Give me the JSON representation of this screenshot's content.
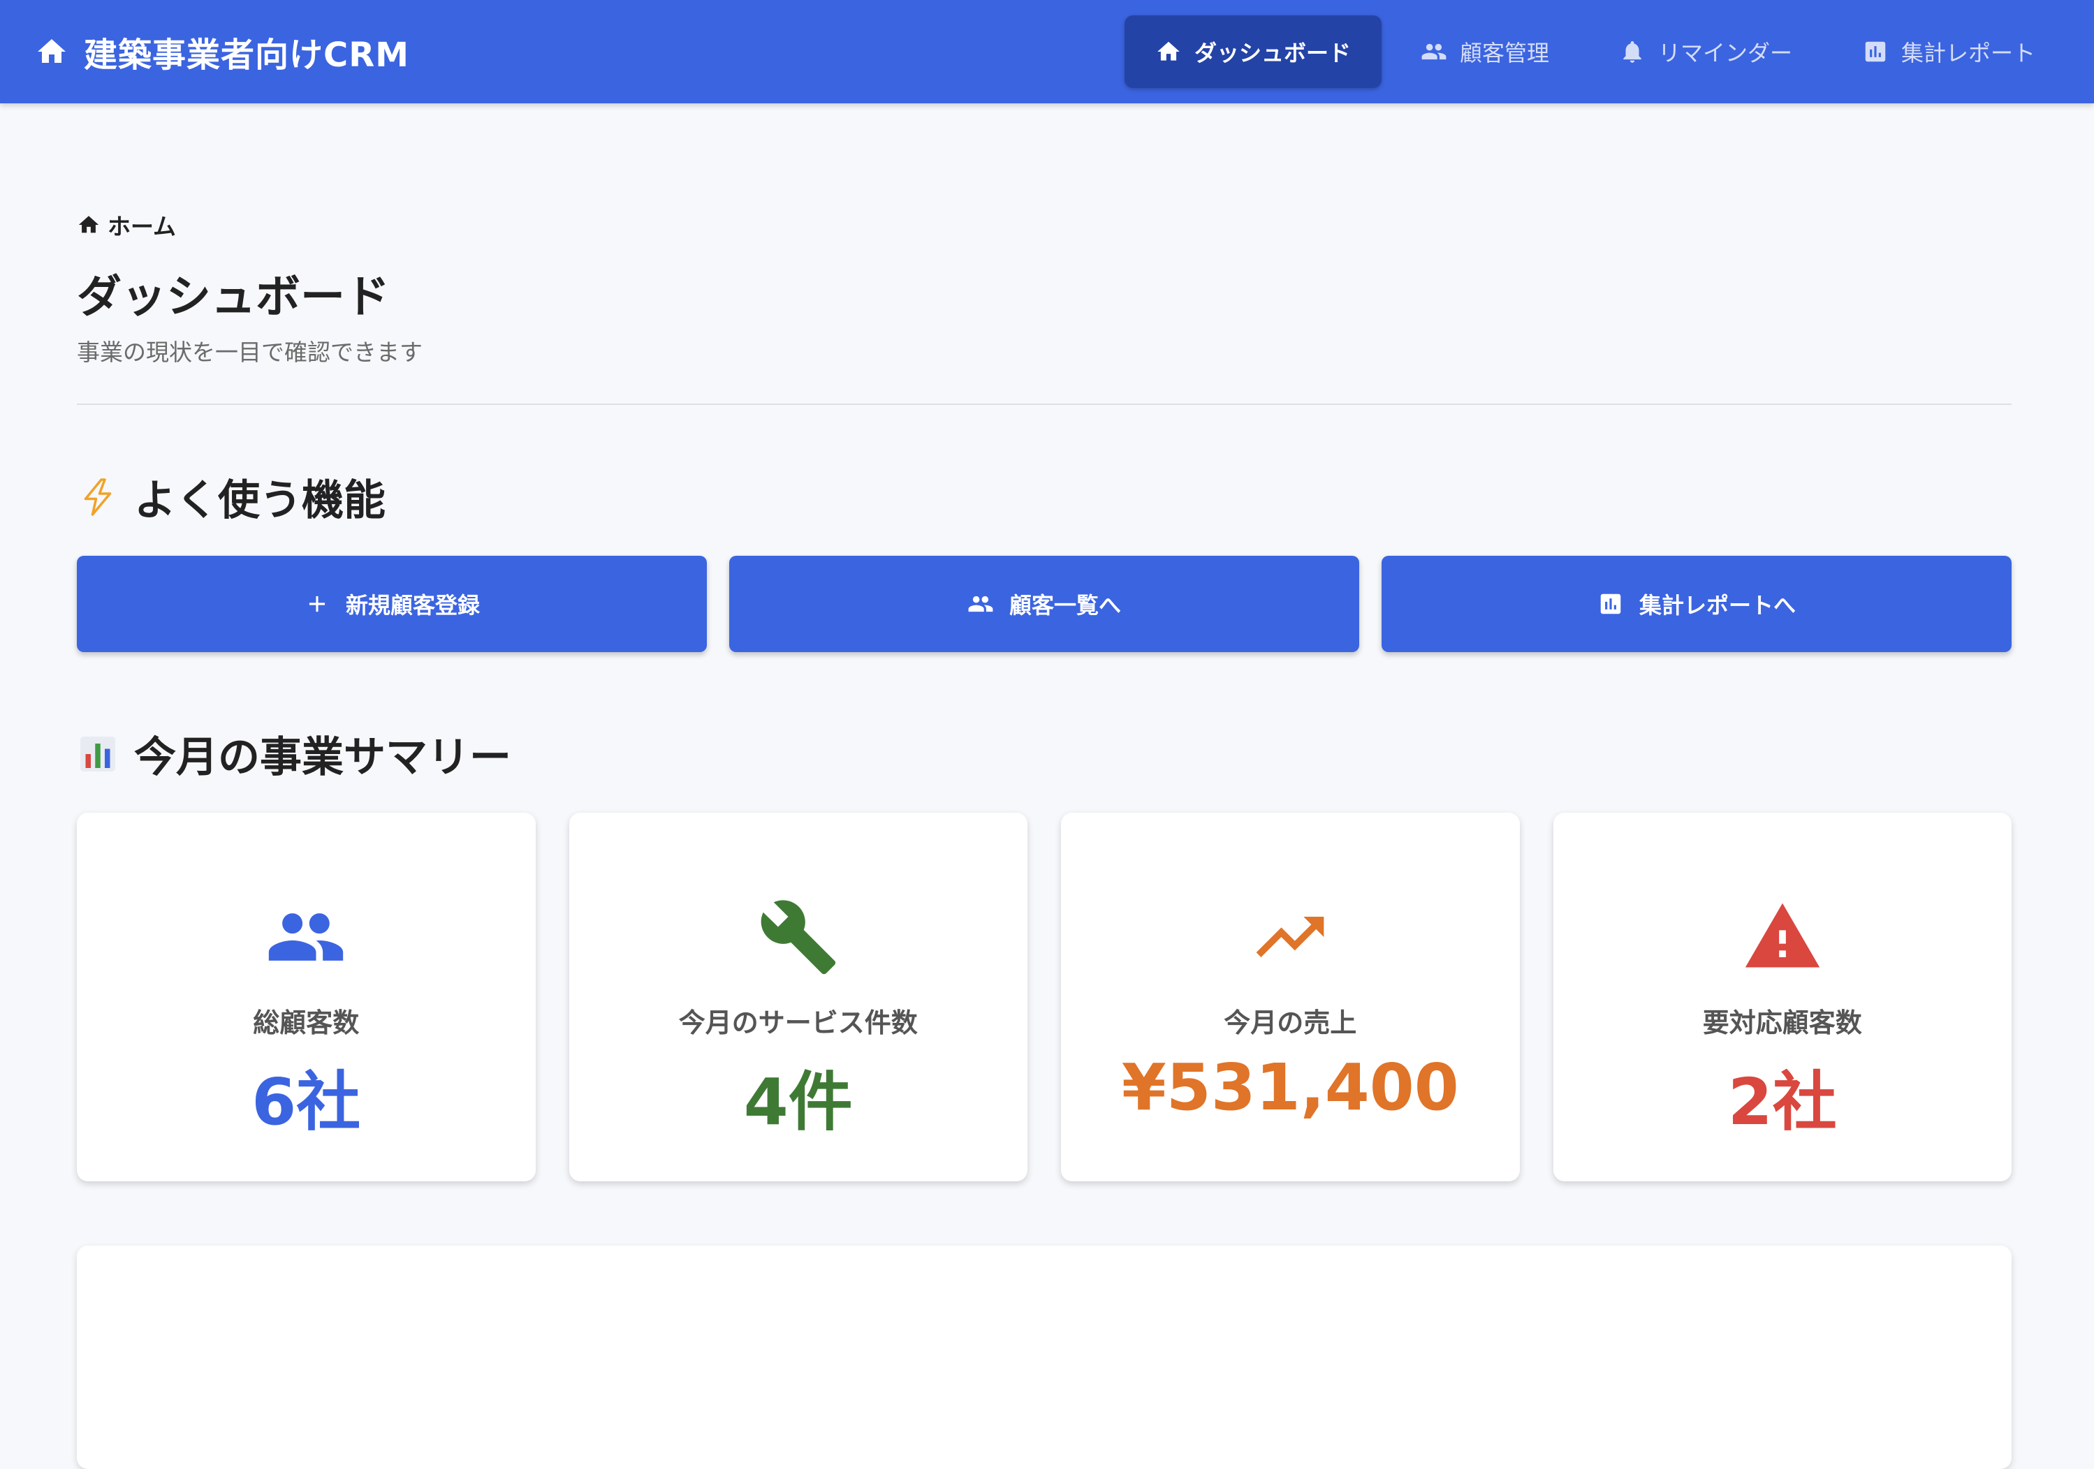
{
  "app": {
    "title": "建築事業者向けCRM"
  },
  "nav": {
    "items": [
      {
        "label": "ダッシュボード",
        "icon": "home-icon",
        "active": true
      },
      {
        "label": "顧客管理",
        "icon": "people-icon",
        "active": false
      },
      {
        "label": "リマインダー",
        "icon": "bell-icon",
        "active": false
      },
      {
        "label": "集計レポート",
        "icon": "report-icon",
        "active": false
      }
    ]
  },
  "breadcrumb": {
    "label": "ホーム",
    "icon": "home-icon"
  },
  "page": {
    "title": "ダッシュボード",
    "subtitle": "事業の現状を一目で確認できます"
  },
  "quick_actions": {
    "title": "よく使う機能",
    "icon": "lightning-icon",
    "buttons": [
      {
        "label": "新規顧客登録",
        "icon": "plus-icon"
      },
      {
        "label": "顧客一覧へ",
        "icon": "people-icon"
      },
      {
        "label": "集計レポートへ",
        "icon": "report-icon"
      }
    ]
  },
  "summary": {
    "title": "今月の事業サマリー",
    "icon": "bar-chart-icon",
    "cards": [
      {
        "label": "総顧客数",
        "value": "6社",
        "icon": "people-icon",
        "color": "#3b64e0"
      },
      {
        "label": "今月のサービス件数",
        "value": "4件",
        "icon": "wrench-icon",
        "color": "#3f7a35"
      },
      {
        "label": "今月の売上",
        "value": "¥531,400",
        "icon": "trending-up-icon",
        "color": "#e07428"
      },
      {
        "label": "要対応顧客数",
        "value": "2社",
        "icon": "warning-icon",
        "color": "#d9473f"
      }
    ]
  },
  "colors": {
    "primary": "#3b64e0",
    "primary_dark": "#2443a6",
    "background": "#f6f8fb"
  }
}
